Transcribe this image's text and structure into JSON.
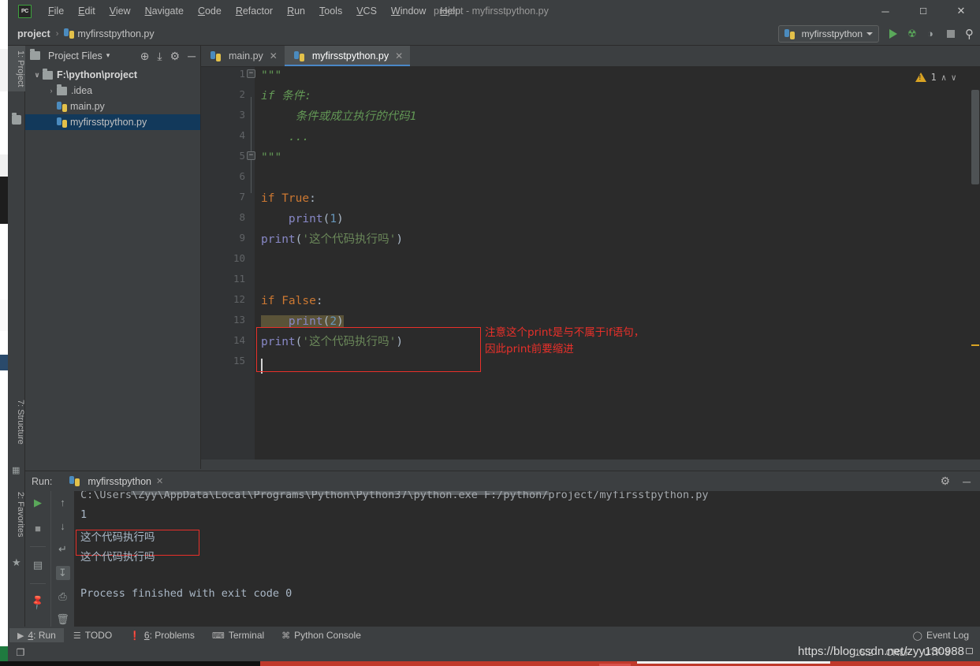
{
  "window": {
    "title": "project - myfirsstpython.py",
    "logo_text": "PC",
    "minimize": "─",
    "maximize": "☐",
    "close": "✕"
  },
  "menu": {
    "items": [
      {
        "label": "File"
      },
      {
        "label": "Edit"
      },
      {
        "label": "View"
      },
      {
        "label": "Navigate"
      },
      {
        "label": "Code"
      },
      {
        "label": "Refactor"
      },
      {
        "label": "Run"
      },
      {
        "label": "Tools"
      },
      {
        "label": "VCS"
      },
      {
        "label": "Window"
      },
      {
        "label": "Help"
      }
    ]
  },
  "breadcrumb": {
    "project": "project",
    "separator": "›",
    "file": "myfirsstpython.py"
  },
  "toolbar": {
    "run_config": "myfirsstpython",
    "run_icon": "play-icon",
    "debug_icon": "bug-icon",
    "coverage_icon": "coverage-icon",
    "stop_icon": "stop-icon",
    "search_icon": "search-icon",
    "bug_glyph": "☢",
    "coverage_glyph": "◑",
    "search_glyph": "⚲"
  },
  "left_strip": {
    "project_tab": "1: Project",
    "structure_tab": "7: Structure",
    "favorites_tab": "2: Favorites"
  },
  "project_panel": {
    "title": "Project Files",
    "dropdown_caret": "▾",
    "tools": [
      {
        "name": "locate-icon",
        "glyph": "⊕"
      },
      {
        "name": "collapse-all-icon",
        "glyph": "⤓"
      },
      {
        "name": "settings-icon",
        "glyph": "⚙"
      },
      {
        "name": "hide-icon",
        "glyph": "─"
      }
    ],
    "tree": [
      {
        "label": "F:\\python\\project",
        "type": "folder",
        "depth": 0,
        "arrow": "∨",
        "selected": false,
        "root": true
      },
      {
        "label": ".idea",
        "type": "folder",
        "depth": 1,
        "arrow": "›",
        "selected": false,
        "root": false
      },
      {
        "label": "main.py",
        "type": "python",
        "depth": 1,
        "arrow": "",
        "selected": false,
        "root": false
      },
      {
        "label": "myfirsstpython.py",
        "type": "python",
        "depth": 1,
        "arrow": "",
        "selected": true,
        "root": false
      }
    ]
  },
  "editor": {
    "tabs": [
      {
        "label": "main.py",
        "active": false,
        "close": "✕"
      },
      {
        "label": "myfirsstpython.py",
        "active": true,
        "close": "✕"
      }
    ],
    "line_numbers": [
      "1",
      "2",
      "3",
      "4",
      "5",
      "6",
      "7",
      "8",
      "9",
      "10",
      "11",
      "12",
      "13",
      "14",
      "15"
    ],
    "code_lines": [
      {
        "n": 1,
        "segments": [
          {
            "t": "\"\"\"",
            "c": "docq"
          }
        ]
      },
      {
        "n": 2,
        "segments": [
          {
            "t": "if 条件:",
            "c": "doc"
          }
        ]
      },
      {
        "n": 3,
        "segments": [
          {
            "t": "     条件或成立执行的代码1",
            "c": "doc"
          }
        ]
      },
      {
        "n": 4,
        "segments": [
          {
            "t": "    ...",
            "c": "doc"
          }
        ]
      },
      {
        "n": 5,
        "segments": [
          {
            "t": "\"\"\"",
            "c": "docq"
          }
        ]
      },
      {
        "n": 6,
        "segments": []
      },
      {
        "n": 7,
        "segments": [
          {
            "t": "if ",
            "c": "kw"
          },
          {
            "t": "True",
            "c": "kw"
          },
          {
            "t": ":",
            "c": "plain"
          }
        ]
      },
      {
        "n": 8,
        "segments": [
          {
            "t": "    ",
            "c": "plain"
          },
          {
            "t": "print",
            "c": "fn"
          },
          {
            "t": "(",
            "c": "paren"
          },
          {
            "t": "1",
            "c": "num"
          },
          {
            "t": ")",
            "c": "paren"
          }
        ]
      },
      {
        "n": 9,
        "segments": [
          {
            "t": "print",
            "c": "fn"
          },
          {
            "t": "(",
            "c": "paren"
          },
          {
            "t": "'这个代码执行吗'",
            "c": "str"
          },
          {
            "t": ")",
            "c": "paren"
          }
        ]
      },
      {
        "n": 10,
        "segments": []
      },
      {
        "n": 11,
        "segments": []
      },
      {
        "n": 12,
        "segments": [
          {
            "t": "if ",
            "c": "kw"
          },
          {
            "t": "False",
            "c": "kw"
          },
          {
            "t": ":",
            "c": "plain"
          }
        ]
      },
      {
        "n": 13,
        "segments": [
          {
            "t": "    ",
            "c": "plain"
          },
          {
            "t": "print",
            "c": "fn"
          },
          {
            "t": "(",
            "c": "paren"
          },
          {
            "t": "2",
            "c": "num"
          },
          {
            "t": ")",
            "c": "paren"
          }
        ],
        "highlight": true
      },
      {
        "n": 14,
        "segments": [
          {
            "t": "print",
            "c": "fn"
          },
          {
            "t": "(",
            "c": "paren"
          },
          {
            "t": "'这个代码执行吗'",
            "c": "str"
          },
          {
            "t": ")",
            "c": "paren"
          }
        ]
      },
      {
        "n": 15,
        "segments": []
      }
    ],
    "annotation": {
      "line1": "注意这个print是与不属于if语句，",
      "line2": "因此print前要缩进"
    },
    "warning_count": "1",
    "warning_icon": "warning-triangle-icon",
    "chevron_up": "∧",
    "chevron_down": "∨"
  },
  "run_panel": {
    "label": "Run:",
    "tab_name": "myfirsstpython",
    "tab_close": "✕",
    "settings_icon": "gear-icon",
    "hide_icon": "minimize-icon",
    "settings_glyph": "⚙",
    "hide_glyph": "─",
    "left_tools": [
      {
        "name": "rerun-button",
        "glyph": "▶"
      },
      {
        "name": "stop-button",
        "glyph": "■"
      },
      {
        "name": "layout-button",
        "glyph": "▤"
      },
      {
        "name": "pin-button",
        "glyph": "✒"
      }
    ],
    "mid_tools": [
      {
        "name": "up-arrow-button",
        "glyph": "↑"
      },
      {
        "name": "down-arrow-button",
        "glyph": "↓"
      },
      {
        "name": "soft-wrap-button",
        "glyph": "↵"
      },
      {
        "name": "scroll-to-end-button",
        "glyph": "↧"
      },
      {
        "name": "print-button",
        "glyph": "⎙"
      },
      {
        "name": "clear-all-button",
        "glyph": "Ὕ1"
      }
    ],
    "console_lines": [
      {
        "text": "C:\\Users\\Zyy\\AppData\\Local\\Programs\\Python\\Python37\\python.exe F:/python/project/myfirsstpython.py",
        "kind": "cmd"
      },
      {
        "text": "1",
        "kind": "out"
      },
      {
        "text": "这个代码执行吗",
        "kind": "out"
      },
      {
        "text": "这个代码执行吗",
        "kind": "out"
      },
      {
        "text": "",
        "kind": "out"
      },
      {
        "text": "Process finished with exit code 0",
        "kind": "out"
      }
    ]
  },
  "bottom_bar": {
    "items": [
      {
        "label": "4: Run",
        "icon": "play-icon",
        "glyph": "▶",
        "selected": true,
        "underline": "4"
      },
      {
        "label": "TODO",
        "icon": "list-icon",
        "glyph": "☰",
        "selected": false,
        "underline": ""
      },
      {
        "label": "6: Problems",
        "icon": "error-icon",
        "glyph": "❗",
        "selected": false,
        "underline": "6"
      },
      {
        "label": "Terminal",
        "icon": "terminal-icon",
        "glyph": "⌨",
        "selected": false,
        "underline": ""
      },
      {
        "label": "Python Console",
        "icon": "python-icon",
        "glyph": "⌘",
        "selected": false,
        "underline": ""
      }
    ],
    "event_log": "Event Log",
    "event_log_icon": "bell-icon",
    "event_log_glyph": "◯"
  },
  "status_bar": {
    "caret_position": "15:2",
    "line_separator": "CRLF",
    "encoding": "UTF-8",
    "lock_icon": "lock-icon",
    "copy_icon": "copy-icon",
    "copy_glyph": "❐"
  },
  "watermark": {
    "text": "https://blog.csdn.net/zyy130988"
  },
  "colors": {
    "accent_blue": "#4a88c7",
    "selection_blue": "#12395b",
    "annotation_red": "#e8302a",
    "keyword_orange": "#cc7832",
    "function_purple": "#8888c6",
    "string_green": "#6a8759",
    "docstring_green": "#629755",
    "number_blue": "#6897bb",
    "warning_yellow": "#d9a323",
    "run_green": "#5aa85a",
    "panel_bg": "#3c3f41",
    "editor_bg": "#2b2b2b"
  }
}
